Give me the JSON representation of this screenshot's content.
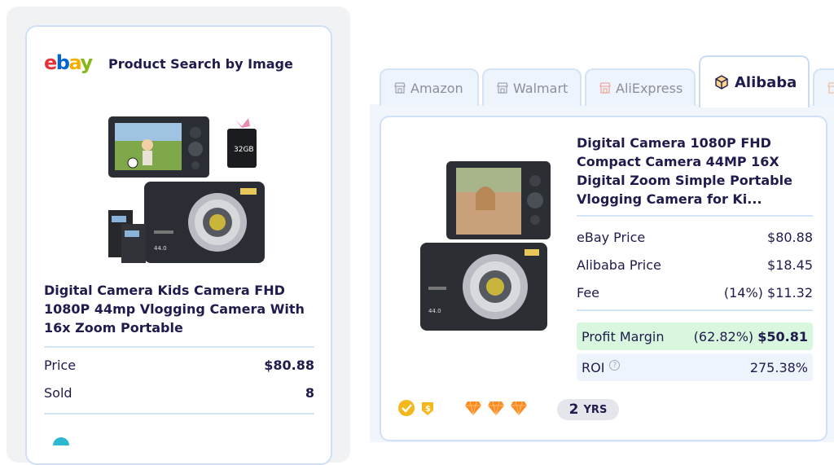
{
  "ebay": {
    "logo": "ebay",
    "header_title": "Product Search by Image",
    "product_image": "ebay-camera-kit-photo",
    "product_title": "Digital Camera Kids Camera FHD 1080P 44mp Vlogging Camera With 16x Zoom Portable",
    "price_label": "Price",
    "price_value": "$80.88",
    "sold_label": "Sold",
    "sold_value": "8"
  },
  "tabs": [
    {
      "label": "Amazon",
      "icon": "store-icon",
      "active": false
    },
    {
      "label": "Walmart",
      "icon": "store-icon",
      "active": false
    },
    {
      "label": "AliExpress",
      "icon": "store-icon",
      "active": false
    },
    {
      "label": "Alibaba",
      "icon": "box-icon",
      "active": true
    }
  ],
  "alibaba": {
    "product_image": "alibaba-camera-photo",
    "product_title": "Digital Camera 1080P FHD Compact Camera 44MP 16X Digital Zoom Simple Portable Vlogging Camera for Ki...",
    "ebay_price_label": "eBay Price",
    "ebay_price_value": "$80.88",
    "alibaba_price_label": "Alibaba Price",
    "alibaba_price_value": "$18.45",
    "fee_label": "Fee",
    "fee_value": "(14%) $11.32",
    "profit_label": "Profit Margin",
    "profit_percent": "(62.82%)",
    "profit_value": "$50.81",
    "roi_label": "ROI",
    "roi_help": "?",
    "roi_value": "275.38%",
    "years_number": "2",
    "years_unit": "YRS",
    "diamond_count": 3
  },
  "colors": {
    "navy_text": "#1f1b4d",
    "profit_bg": "#d9f7de",
    "divider": "#d5e6f8",
    "diamond": "#ff8a1f",
    "gold": "#f5b81c"
  }
}
